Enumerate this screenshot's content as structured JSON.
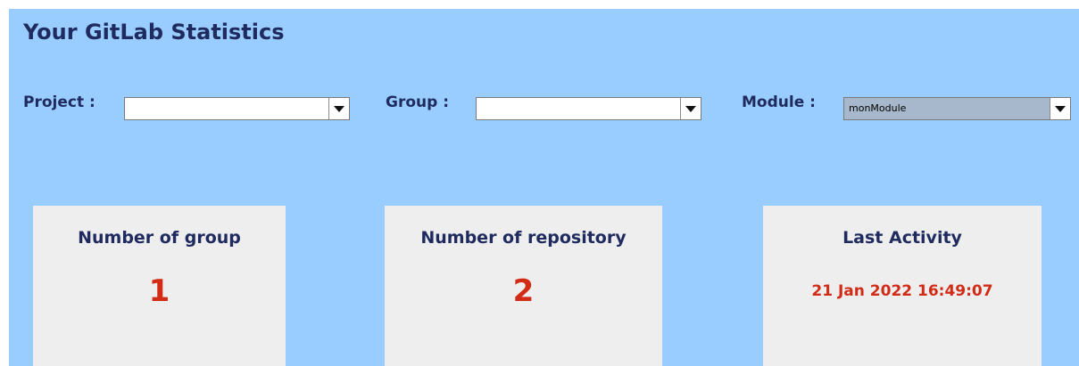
{
  "title": "Your GitLab Statistics",
  "filters": {
    "project": {
      "label": "Project :",
      "value": ""
    },
    "group": {
      "label": "Group :",
      "value": ""
    },
    "module": {
      "label": "Module :",
      "value": "monModule"
    }
  },
  "icons": {
    "dropdown": "chevron-down-icon"
  },
  "stats": {
    "groups": {
      "label": "Number of group",
      "value": "1"
    },
    "repositories": {
      "label": "Number of repository",
      "value": "2"
    },
    "last_activity": {
      "label": "Last Activity",
      "value": "21 Jan 2022 16:49:07"
    }
  },
  "colors": {
    "background": "#99ccff",
    "card": "#eeeeee",
    "label_text": "#1f2a5e",
    "value_text": "#d22b16",
    "selected_combo": "#a8b8cc"
  }
}
